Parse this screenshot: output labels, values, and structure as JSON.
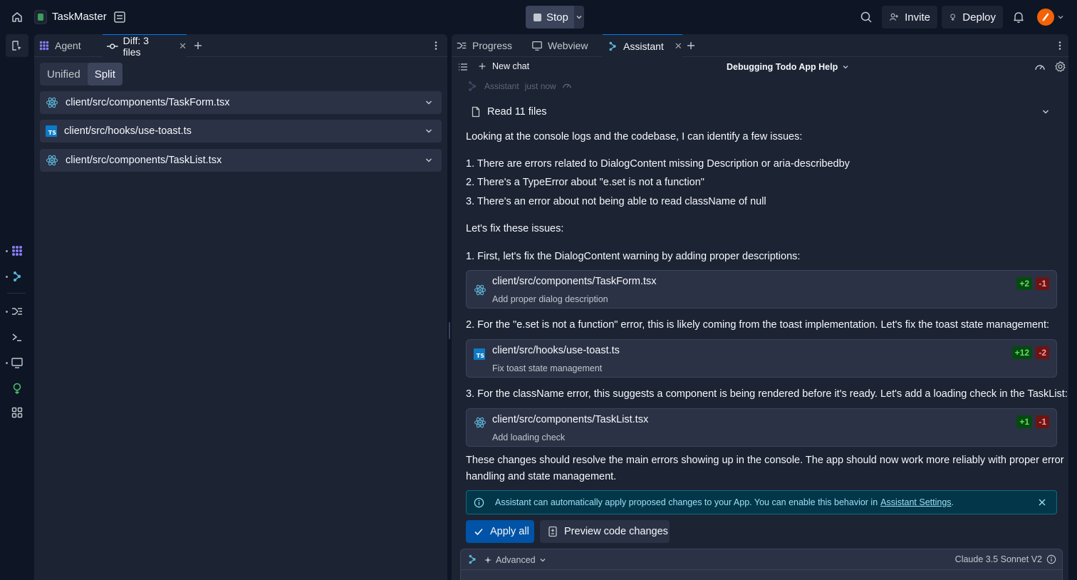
{
  "app": {
    "name": "TaskMaster"
  },
  "topbar": {
    "stop_label": "Stop",
    "invite_label": "Invite",
    "deploy_label": "Deploy"
  },
  "left_pane": {
    "tabs": [
      {
        "label": "Agent",
        "icon": "agent-icon"
      },
      {
        "label": "Diff: 3 files",
        "icon": "git-commit-icon",
        "closable": true
      }
    ],
    "view_modes": [
      "Unified",
      "Split"
    ],
    "selected_view_mode": "Split",
    "files": [
      {
        "path": "client/src/components/TaskForm.tsx",
        "icon": "react-icon"
      },
      {
        "path": "client/src/hooks/use-toast.ts",
        "icon": "typescript-icon"
      },
      {
        "path": "client/src/components/TaskList.tsx",
        "icon": "react-icon"
      }
    ]
  },
  "right_pane": {
    "tabs": [
      {
        "label": "Progress",
        "icon": "progress-icon"
      },
      {
        "label": "Webview",
        "icon": "monitor-icon"
      },
      {
        "label": "Assistant",
        "icon": "assistant-icon",
        "closable": true
      }
    ],
    "new_chat_label": "New chat",
    "chat_title": "Debugging Todo App Help",
    "message": {
      "author": "Assistant",
      "time": "just now",
      "read_files_label": "Read 11 files",
      "intro": "Looking at the console logs and the codebase, I can identify a few issues:",
      "issues": [
        "1. There are errors related to DialogContent missing Description or aria-describedby",
        "2. There's a TypeError about \"e.set is not a function\"",
        "3. There's an error about not being able to read className of null"
      ],
      "fix_intro": "Let's fix these issues:",
      "steps": [
        "1. First, let's fix the DialogContent warning by adding proper descriptions:",
        "2. For the \"e.set is not a function\" error, this is likely coming from the toast implementation. Let's fix the toast state management:",
        "3. For the className error, this suggests a component is being rendered before it's ready. Let's add a loading check in the TaskList:"
      ],
      "changes": [
        {
          "path": "client/src/components/TaskForm.tsx",
          "desc": "Add proper dialog description",
          "add": "+2",
          "del": "-1",
          "icon": "react-icon"
        },
        {
          "path": "client/src/hooks/use-toast.ts",
          "desc": "Fix toast state management",
          "add": "+12",
          "del": "-2",
          "icon": "typescript-icon"
        },
        {
          "path": "client/src/components/TaskList.tsx",
          "desc": "Add loading check",
          "add": "+1",
          "del": "-1",
          "icon": "react-icon"
        }
      ],
      "conclusion_1": "These changes should resolve the main errors showing up in the console. The app should now work more reliably with proper error",
      "conclusion_2": "handling and state management."
    },
    "banner": {
      "text": "Assistant can automatically apply proposed changes to your App. You can enable this behavior in",
      "link": "Assistant Settings",
      "suffix": "."
    },
    "apply_all_label": "Apply all",
    "preview_label": "Preview code changes",
    "composer": {
      "advanced_label": "Advanced",
      "model": "Claude 3.5 Sonnet V2"
    }
  },
  "colors": {
    "bg": "#0e1525",
    "panel": "#1c2333",
    "accent": "#0079f2",
    "add": "#6bd968",
    "del": "#f29c9c"
  }
}
